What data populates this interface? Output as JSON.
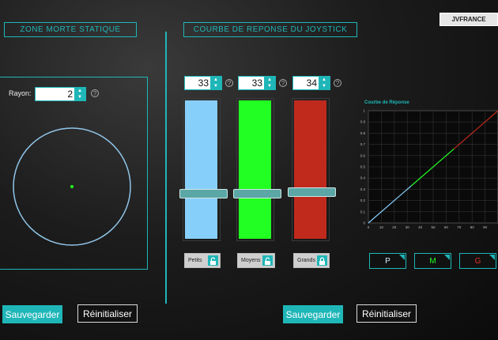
{
  "header": {
    "user": "JVFRANCE"
  },
  "deadzone": {
    "title": "ZONE MORTE STATIQUE",
    "radius_label": "Rayon:",
    "radius_value": "2",
    "help": "?"
  },
  "curve_section": {
    "title": "COURBE DE REPONSE DU JOYSTICK",
    "sliders": [
      {
        "value": "33",
        "level": 0.33,
        "color": "#87cffb",
        "lock_label": "Petits",
        "locked": false
      },
      {
        "value": "33",
        "level": 0.33,
        "color": "#22ff22",
        "lock_label": "Moyens",
        "locked": false
      },
      {
        "value": "34",
        "level": 0.34,
        "color": "#c02a1c",
        "lock_label": "Grands",
        "locked": true
      }
    ],
    "help": "?"
  },
  "chart_data": {
    "type": "line",
    "title": "Courbe de Réponse",
    "xlim": [
      0,
      100
    ],
    "ylim": [
      0,
      1
    ],
    "x_ticks": [
      "0",
      "10",
      "20",
      "30",
      "40",
      "50",
      "60",
      "70",
      "80",
      "90"
    ],
    "y_ticks": [
      "0",
      "0.1",
      "0.2",
      "0.3",
      "0.4",
      "0.5",
      "0.6",
      "0.7",
      "0.8",
      "0.9",
      "1"
    ],
    "grid": true,
    "series": [
      {
        "color": "#87cffb",
        "x": [
          0,
          33
        ],
        "y": [
          0,
          0.33
        ]
      },
      {
        "color": "#22ff22",
        "x": [
          33,
          66
        ],
        "y": [
          0.33,
          0.66
        ]
      },
      {
        "color": "#c02a1c",
        "x": [
          66,
          100
        ],
        "y": [
          0.66,
          1.0
        ]
      }
    ]
  },
  "range_buttons": [
    {
      "label": "P",
      "color": "#cfefff"
    },
    {
      "label": "M",
      "color": "#22ff22"
    },
    {
      "label": "G",
      "color": "#e0321e"
    }
  ],
  "buttons": {
    "save": "Sauvegarder",
    "reset": "Réinitialiser"
  }
}
